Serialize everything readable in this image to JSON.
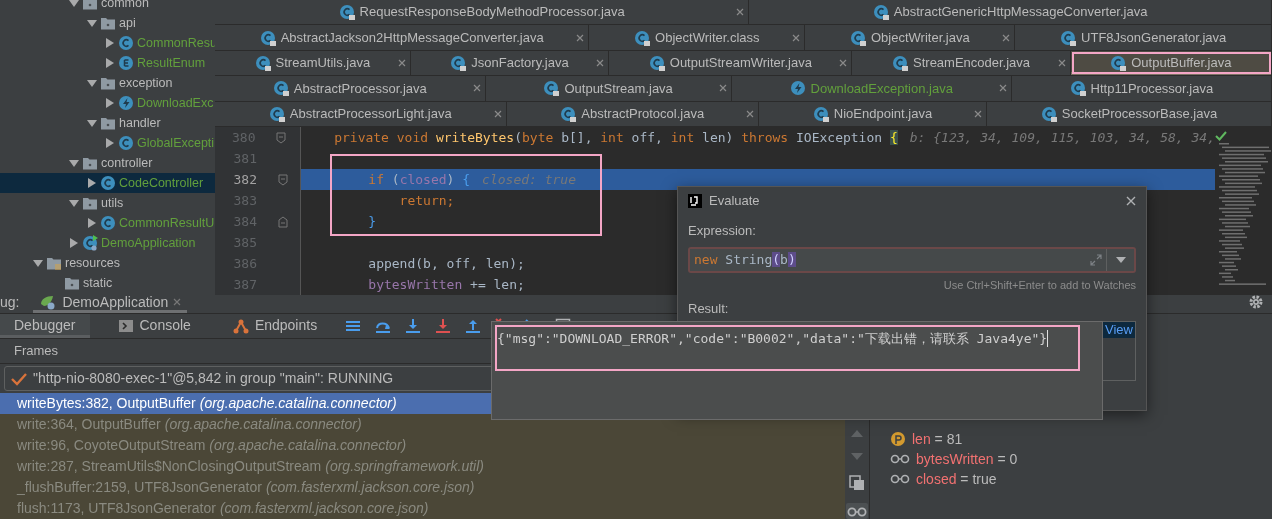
{
  "project_tree": {
    "package_contents": [
      {
        "label": "common",
        "kind": "folder",
        "expanded": true,
        "selected": false,
        "children": [
          {
            "label": "api",
            "kind": "folder",
            "expanded": true,
            "selected": false,
            "children": [
              {
                "label": "CommonResu",
                "kind": "class",
                "expanded": false,
                "selected": false
              },
              {
                "label": "ResultEnum",
                "kind": "enum",
                "expanded": false,
                "selected": false
              }
            ]
          },
          {
            "label": "exception",
            "kind": "folder",
            "expanded": true,
            "selected": false,
            "children": [
              {
                "label": "DownloadExc",
                "kind": "exception",
                "expanded": false,
                "selected": false
              }
            ]
          },
          {
            "label": "handler",
            "kind": "folder",
            "expanded": true,
            "selected": false,
            "children": [
              {
                "label": "GlobalExcepti",
                "kind": "class",
                "expanded": false,
                "selected": false
              }
            ]
          }
        ]
      },
      {
        "label": "controller",
        "kind": "folder",
        "expanded": true,
        "selected": false,
        "children": [
          {
            "label": "CodeController",
            "kind": "class",
            "expanded": false,
            "selected": true
          }
        ]
      },
      {
        "label": "utils",
        "kind": "folder",
        "expanded": true,
        "selected": false,
        "children": [
          {
            "label": "CommonResultU",
            "kind": "class",
            "expanded": false,
            "selected": false
          }
        ]
      },
      {
        "label": "DemoApplication",
        "kind": "application",
        "expanded": false,
        "selected": false
      }
    ],
    "root_items": [
      {
        "label": "resources",
        "kind": "resources",
        "expanded": true,
        "selected": false,
        "children": [
          {
            "label": "static",
            "kind": "folder",
            "selected": false
          }
        ]
      }
    ]
  },
  "editor_tabs": [
    {
      "tabs": [
        {
          "label": "RequestResponseBodyMethodProcessor.java",
          "kind": "library_class",
          "selected": false,
          "annotated": false
        },
        {
          "label": "AbstractGenericHttpMessageConverter.java",
          "kind": "library_class",
          "selected": false,
          "annotated": false
        }
      ]
    },
    {
      "tabs": [
        {
          "label": "AbstractJackson2HttpMessageConverter.java",
          "kind": "library_class",
          "selected": false,
          "annotated": false
        },
        {
          "label": "ObjectWriter.class",
          "kind": "library_class",
          "selected": false,
          "annotated": false
        },
        {
          "label": "ObjectWriter.java",
          "kind": "library_class",
          "selected": false,
          "annotated": false
        },
        {
          "label": "UTF8JsonGenerator.java",
          "kind": "library_class",
          "selected": false,
          "annotated": false
        }
      ]
    },
    {
      "tabs": [
        {
          "label": "StreamUtils.java",
          "kind": "library_class",
          "selected": false,
          "annotated": false
        },
        {
          "label": "JsonFactory.java",
          "kind": "library_class",
          "selected": false,
          "annotated": false
        },
        {
          "label": "OutputStreamWriter.java",
          "kind": "library_class",
          "selected": false,
          "annotated": false
        },
        {
          "label": "StreamEncoder.java",
          "kind": "library_class",
          "selected": false,
          "annotated": false
        },
        {
          "label": "OutputBuffer.java",
          "kind": "library_class",
          "selected": true,
          "annotated": true
        }
      ]
    },
    {
      "tabs": [
        {
          "label": "AbstractProcessor.java",
          "kind": "library_class",
          "selected": false,
          "annotated": false
        },
        {
          "label": "OutputStream.java",
          "kind": "library_class",
          "selected": false,
          "annotated": false
        },
        {
          "label": "DownloadException.java",
          "kind": "exception",
          "selected": false,
          "annotated": false
        },
        {
          "label": "Http11Processor.java",
          "kind": "library_class",
          "selected": false,
          "annotated": false
        }
      ]
    },
    {
      "tabs": [
        {
          "label": "AbstractProcessorLight.java",
          "kind": "library_class",
          "selected": false,
          "annotated": false
        },
        {
          "label": "AbstractProtocol.java",
          "kind": "library_class",
          "selected": false,
          "annotated": false
        },
        {
          "label": "NioEndpoint.java",
          "kind": "library_class",
          "selected": false,
          "annotated": false
        },
        {
          "label": "SocketProcessorBase.java",
          "kind": "library_class",
          "selected": false,
          "annotated": false
        }
      ]
    }
  ],
  "code_lines": [
    {
      "number": "380",
      "fold_start": true,
      "execution_point": false,
      "annotated": false,
      "inline_value": "b: {123, 34, 109, 115, 103, 34, 58, 34,",
      "segments": [
        {
          "text": "private void ",
          "kind": "keyword"
        },
        {
          "text": "writeBytes",
          "kind": "method"
        },
        {
          "text": "(",
          "kind": "plain"
        },
        {
          "text": "byte ",
          "kind": "keyword"
        },
        {
          "text": "b[], ",
          "kind": "plain"
        },
        {
          "text": "int ",
          "kind": "keyword"
        },
        {
          "text": "off, ",
          "kind": "plain"
        },
        {
          "text": "int ",
          "kind": "keyword"
        },
        {
          "text": "len) ",
          "kind": "plain"
        },
        {
          "text": "throws ",
          "kind": "keyword"
        },
        {
          "text": "IOException ",
          "kind": "plain"
        },
        {
          "text": "{",
          "kind": "brace_match"
        }
      ]
    },
    {
      "number": "381",
      "execution_point": false,
      "annotated": true
    },
    {
      "number": "382",
      "fold_start": true,
      "execution_point": true,
      "annotated": true,
      "inline_value": "closed: true",
      "segments": [
        {
          "text": "    if ",
          "kind": "keyword"
        },
        {
          "text": "(",
          "kind": "plain"
        },
        {
          "text": "closed",
          "kind": "field"
        },
        {
          "text": ") ",
          "kind": "plain"
        },
        {
          "text": "{",
          "kind": "brace_pair"
        }
      ]
    },
    {
      "number": "383",
      "execution_point": false,
      "annotated": true,
      "segments": [
        {
          "text": "        return;",
          "kind": "keyword"
        }
      ]
    },
    {
      "number": "384",
      "fold_end": true,
      "execution_point": false,
      "annotated": true,
      "segments": [
        {
          "text": "    }",
          "kind": "brace_pair"
        }
      ]
    },
    {
      "number": "385",
      "execution_point": false,
      "annotated": false
    },
    {
      "number": "386",
      "execution_point": false,
      "annotated": false,
      "segments": [
        {
          "text": "    append(b, off, len);",
          "kind": "plain"
        }
      ]
    },
    {
      "number": "387",
      "execution_point": false,
      "annotated": false,
      "segments": [
        {
          "text": "    bytesWritten",
          "kind": "field"
        },
        {
          "text": " += len;",
          "kind": "plain"
        }
      ]
    }
  ],
  "debug_panel": {
    "title": "ug:",
    "run_tab": "DemoApplication",
    "tabs": [
      {
        "label": "Debugger",
        "kind": "debugger",
        "selected": true
      },
      {
        "label": "Console",
        "kind": "console",
        "selected": false
      },
      {
        "label": "Endpoints",
        "kind": "endpoints",
        "selected": false
      }
    ],
    "frames_label": "Frames",
    "thread": "\"http-nio-8080-exec-1\"@5,842 in group \"main\": RUNNING",
    "frames": [
      {
        "location": "writeBytes:382, OutputBuffer",
        "package": "(org.apache.catalina.connector)",
        "selected": true
      },
      {
        "location": "write:364, OutputBuffer",
        "package": "(org.apache.catalina.connector)",
        "selected": false
      },
      {
        "location": "write:96, CoyoteOutputStream",
        "package": "(org.apache.catalina.connector)",
        "selected": false
      },
      {
        "location": "write:287, StreamUtils$NonClosingOutputStream",
        "package": "(org.springframework.util)",
        "selected": false
      },
      {
        "location": "_flushBuffer:2159, UTF8JsonGenerator",
        "package": "(com.fasterxml.jackson.core.json)",
        "selected": false
      },
      {
        "location": "flush:1173, UTF8JsonGenerator",
        "package": "(com.fasterxml.jackson.core.json)",
        "selected": false
      }
    ],
    "variables": [
      {
        "kind": "parameter",
        "name": "len",
        "value": "= 81"
      },
      {
        "kind": "field",
        "name": "bytesWritten",
        "value": "= 0"
      },
      {
        "kind": "field",
        "name": "closed",
        "value": "= true"
      }
    ]
  },
  "evaluate_dialog": {
    "title": "Evaluate",
    "expression_label": "Expression:",
    "expression": [
      {
        "text": "new ",
        "kind": "keyword"
      },
      {
        "text": "String",
        "kind": "plain"
      },
      {
        "text": "(",
        "kind": "paren_match"
      },
      {
        "text": "b",
        "kind": "plain"
      },
      {
        "text": ")",
        "kind": "paren_match"
      }
    ],
    "hint": "Use Ctrl+Shift+Enter to add to Watches",
    "result_label": "Result:",
    "result_link": "View"
  },
  "result_popup": {
    "text": "{\"msg\":\"DOWNLOAD_ERROR\",\"code\":\"B0002\",\"data\":\"下载出错，请联系 Java4ye\"}",
    "annotated": true
  }
}
